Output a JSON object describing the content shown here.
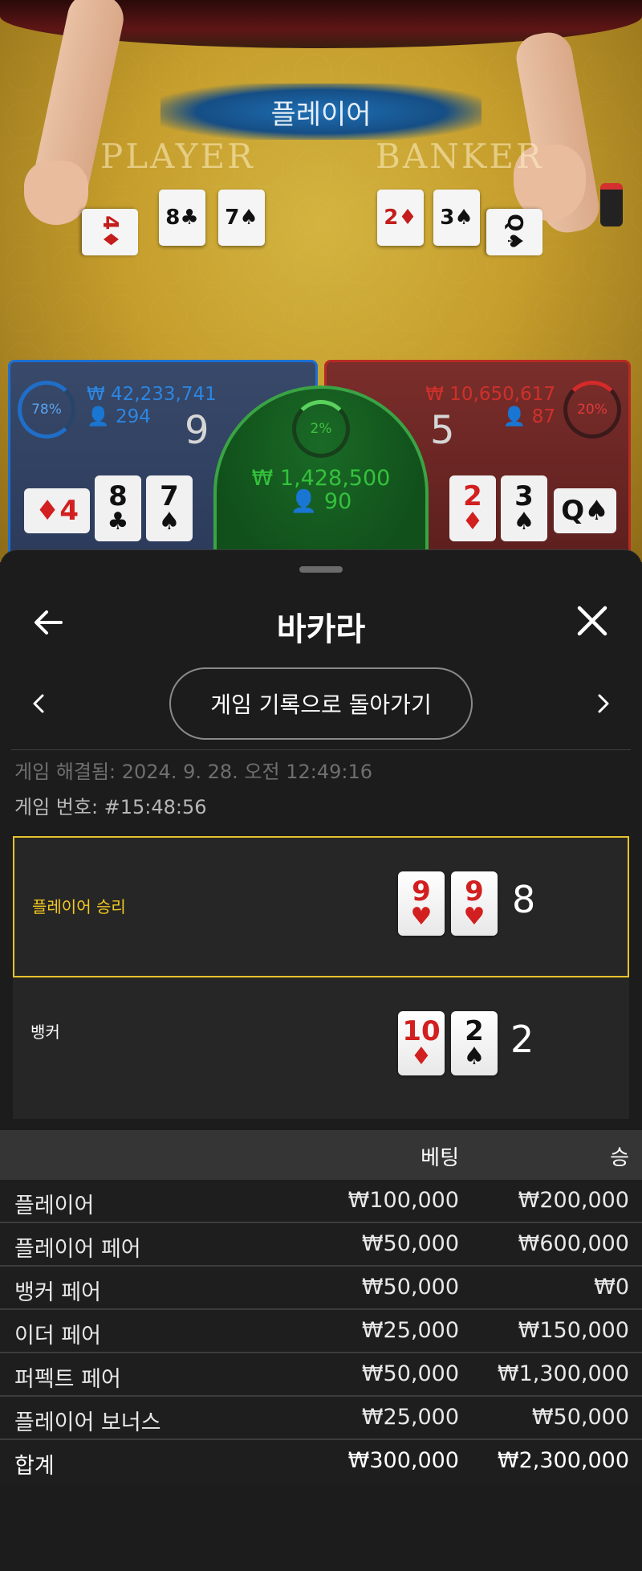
{
  "video": {
    "result_banner": "플레이어",
    "player_label": "PLAYER",
    "banker_label": "BANKER",
    "player_cards": [
      {
        "rank": "4",
        "suit": "♦",
        "color": "red"
      },
      {
        "rank": "8",
        "suit": "♣",
        "color": "black"
      },
      {
        "rank": "7",
        "suit": "♠",
        "color": "black"
      }
    ],
    "banker_cards": [
      {
        "rank": "2",
        "suit": "♦",
        "color": "red"
      },
      {
        "rank": "3",
        "suit": "♠",
        "color": "black"
      },
      {
        "rank": "Q",
        "suit": "♠",
        "color": "black"
      }
    ]
  },
  "stats": {
    "player": {
      "percent": "78%",
      "amount": "₩ 42,233,741",
      "count": "294",
      "score": "9",
      "color": "#2c86e2"
    },
    "banker": {
      "percent": "20%",
      "amount": "₩ 10,650,617",
      "count": "87",
      "score": "5",
      "color": "#d0302b"
    },
    "tie": {
      "percent": "2%",
      "amount": "₩ 1,428,500",
      "count": "90",
      "color": "#34c23c"
    }
  },
  "sheet": {
    "title": "바카라",
    "return_button": "게임 기록으로 돌아가기",
    "resolved": "게임 해결됨: 2024. 9. 28. 오전 12:49:16",
    "game_number": "게임 번호: #15:48:56"
  },
  "outcome": {
    "player": {
      "label": "플레이어 승리",
      "score": "8",
      "cards": [
        {
          "rank": "9",
          "suit": "♥",
          "color": "red"
        },
        {
          "rank": "9",
          "suit": "♥",
          "color": "red"
        }
      ]
    },
    "banker": {
      "label": "뱅커",
      "score": "2",
      "cards": [
        {
          "rank": "10",
          "suit": "♦",
          "color": "red"
        },
        {
          "rank": "2",
          "suit": "♠",
          "color": "black"
        }
      ]
    }
  },
  "bets": {
    "header": {
      "bet": "베팅",
      "win": "승"
    },
    "rows": [
      {
        "name": "플레이어",
        "bet": "₩100,000",
        "win": "₩200,000"
      },
      {
        "name": "플레이어 페어",
        "bet": "₩50,000",
        "win": "₩600,000"
      },
      {
        "name": "뱅커 페어",
        "bet": "₩50,000",
        "win": "₩0"
      },
      {
        "name": "이더 페어",
        "bet": "₩25,000",
        "win": "₩150,000"
      },
      {
        "name": "퍼펙트 페어",
        "bet": "₩50,000",
        "win": "₩1,300,000"
      },
      {
        "name": "플레이어 보너스",
        "bet": "₩25,000",
        "win": "₩50,000"
      }
    ],
    "total": {
      "name": "합계",
      "bet": "₩300,000",
      "win": "₩2,300,000"
    }
  },
  "icons": {
    "back": "arrow-left-icon",
    "close": "close-icon",
    "prev": "chevron-left-icon",
    "next": "chevron-right-icon",
    "user": "user-icon"
  },
  "colors": {
    "accent_gold": "#e6c22b",
    "player_blue": "#1d6fd3",
    "banker_red": "#b72a22",
    "tie_green": "#3aa445"
  }
}
